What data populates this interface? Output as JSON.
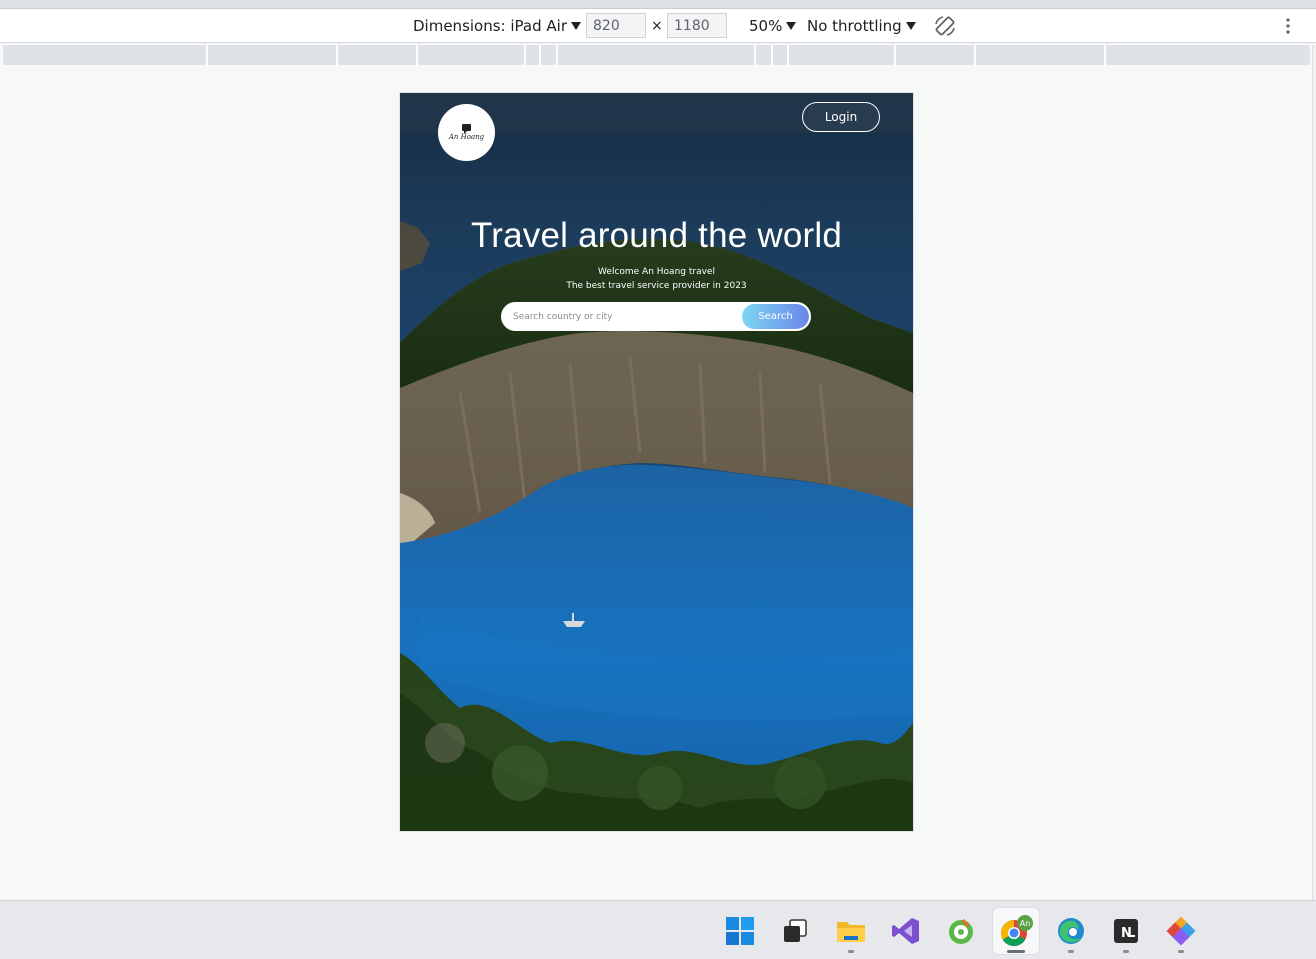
{
  "devtools": {
    "dimensions_label": "Dimensions: iPad Air",
    "width_value": "820",
    "times_symbol": "×",
    "height_value": "1180",
    "zoom_label": "50%",
    "throttling_label": "No throttling",
    "rotate_icon": "rotate-icon",
    "more_icon": "vertical-dots-icon"
  },
  "site": {
    "logo_text": "An Hoang",
    "login_label": "Login",
    "hero_title": "Travel around the world",
    "subtitle_line1": "Welcome An Hoang travel",
    "subtitle_line2": "The best travel service provider in 2023",
    "search_placeholder": "Search country or city",
    "search_button_label": "Search"
  },
  "taskbar": {
    "apps": [
      "windows-start",
      "task-view",
      "file-explorer",
      "visual-studio",
      "coc-coc-browser",
      "chrome",
      "edge",
      "notion",
      "pinned-app"
    ],
    "chrome_profile_badge": "An"
  },
  "colors": {
    "accent_gradient_start": "#7dd6f2",
    "accent_gradient_end": "#6a86ea"
  }
}
